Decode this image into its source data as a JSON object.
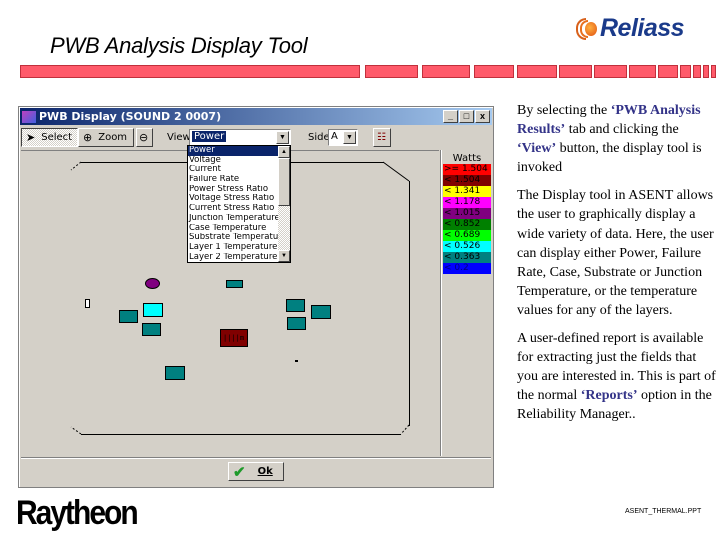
{
  "slide": {
    "title": "PWB Analysis Display Tool",
    "logo_text": "Reliass",
    "footer_brand": "Raytheon",
    "footer_file": "ASENT_THERMAL.PPT",
    "accent_color": "#ff5a6a"
  },
  "window": {
    "title": "PWB Display (SOUND 2 0007)",
    "controls": {
      "minimize": "_",
      "maximize": "□",
      "close": "x"
    }
  },
  "toolbar": {
    "select_label": "Select",
    "zoom_label": "Zoom",
    "view_label": "View:",
    "view_value": "Power",
    "side_label": "Side:",
    "side_value": "A"
  },
  "view_dropdown": {
    "options": [
      "Power",
      "Voltage",
      "Current",
      "Failure Rate",
      "Power Stress Ratio",
      "Voltage Stress Ratio",
      "Current Stress Ratio",
      "Junction Temperature",
      "Case Temperature",
      "Substrate Temperature",
      "Layer 1 Temperature",
      "Layer 2 Temperature"
    ],
    "selected": "Power"
  },
  "legend": {
    "title": "Watts",
    "rows": [
      {
        "label": ">= 1.504",
        "color": "#ff0000",
        "text_color": "#000000"
      },
      {
        "label": "< 1.504",
        "color": "#800000",
        "text_color": "#000000"
      },
      {
        "label": "< 1.341",
        "color": "#ffff00",
        "text_color": "#000000"
      },
      {
        "label": "< 1.178",
        "color": "#ff00ff",
        "text_color": "#000000"
      },
      {
        "label": "< 1.015",
        "color": "#800080",
        "text_color": "#000000"
      },
      {
        "label": "< 0.852",
        "color": "#008000",
        "text_color": "#000000"
      },
      {
        "label": "< 0.689",
        "color": "#00ff00",
        "text_color": "#000000"
      },
      {
        "label": "< 0.526",
        "color": "#00ffff",
        "text_color": "#000000"
      },
      {
        "label": "< 0.363",
        "color": "#008080",
        "text_color": "#000000"
      },
      {
        "label": "< 0.2",
        "color": "#0000ff",
        "text_color": "#000080"
      }
    ]
  },
  "board": {
    "components": [
      {
        "name": "purple-oval",
        "color": "#800080"
      },
      {
        "name": "teal-small-top",
        "color": "#008080"
      },
      {
        "name": "outline-small",
        "color": "#ffffff"
      },
      {
        "name": "cyan",
        "color": "#00ffff"
      },
      {
        "name": "teal-left",
        "color": "#008080"
      },
      {
        "name": "teal-mid",
        "color": "#008080"
      },
      {
        "name": "maroon",
        "color": "#800000",
        "label": "||||m"
      },
      {
        "name": "teal-right-1",
        "color": "#008080"
      },
      {
        "name": "teal-right-2",
        "color": "#008080"
      },
      {
        "name": "teal-right-3",
        "color": "#008080"
      },
      {
        "name": "teal-bottom",
        "color": "#008080"
      }
    ]
  },
  "ok_button": {
    "label": "Ok"
  },
  "description": {
    "p1_pre": "By selecting the ",
    "p1_hl1": "‘PWB Analysis Results’",
    "p1_mid": " tab and clicking the ",
    "p1_hl2": "‘View’",
    "p1_post": " button, the display tool is invoked",
    "p2": "The Display tool in ASENT allows the user to graphically display a wide variety of data. Here, the user can display either Power, Failure Rate, Case, Substrate or Junction Temperature, or the temperature values for any of the layers.",
    "p3_pre": "A user-defined report is available for extracting just the fields that you are interested in. This is part of the normal ",
    "p3_hl": "‘Reports’",
    "p3_post": " option in the Reliability Manager.."
  }
}
